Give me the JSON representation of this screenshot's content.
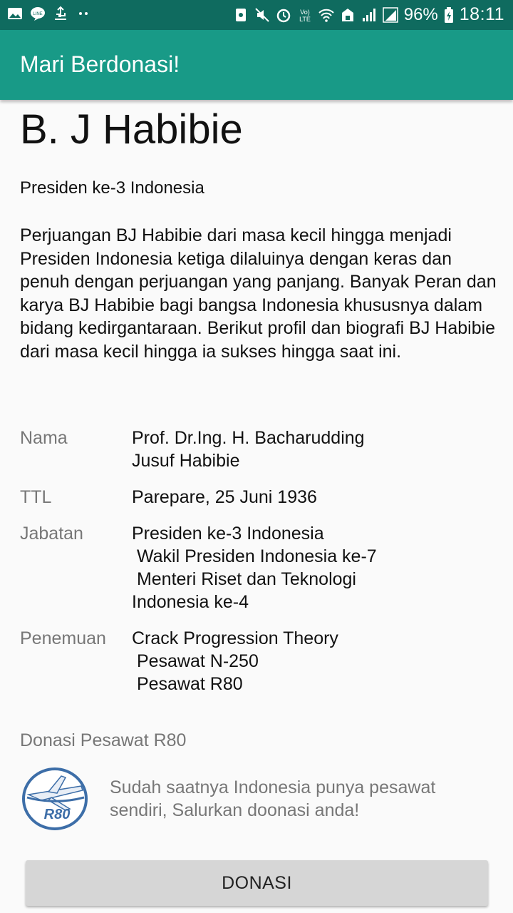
{
  "status_bar": {
    "battery": "96%",
    "time": "18:11",
    "left_icons": [
      "image-icon",
      "line-icon",
      "usb-icon",
      "dots-icon"
    ],
    "right_icons": [
      "nfc-icon",
      "mute-icon",
      "alarm-icon",
      "volte-icon",
      "wifi-icon",
      "data-icon",
      "signal-icon",
      "signal2-icon",
      "battery-icon"
    ]
  },
  "appbar": {
    "title": "Mari Berdonasi!"
  },
  "profile": {
    "name": "B. J Habibie",
    "subtitle": "Presiden ke-3 Indonesia",
    "bio": "Perjuangan BJ Habibie dari masa kecil hingga menjadi Presiden Indonesia ketiga dilaluinya dengan keras dan penuh dengan perjuangan yang panjang. Banyak Peran dan karya BJ Habibie bagi bangsa Indonesia khususnya dalam bidang kedirgantaraan. Berikut profil dan biografi BJ Habibie dari masa kecil hingga ia sukses hingga saat ini."
  },
  "info": [
    {
      "label": "Nama",
      "value": "Prof. Dr.Ing. H. Bacharudding\nJusuf Habibie"
    },
    {
      "label": "TTL",
      "value": "Parepare, 25 Juni 1936"
    },
    {
      "label": "Jabatan",
      "value": "Presiden ke-3 Indonesia\n Wakil Presiden Indonesia ke-7\n Menteri Riset dan Teknologi\nIndonesia ke-4"
    },
    {
      "label": "Penemuan",
      "value": "Crack Progression Theory\n Pesawat N-250\n Pesawat R80"
    }
  ],
  "donation": {
    "title": "Donasi Pesawat R80",
    "logo_text": "R80",
    "description": "Sudah saatnya Indonesia punya pesawat sendiri, Salurkan doonasi anda!",
    "button_label": "DONASI"
  },
  "colors": {
    "status_bar": "#0f6b5f",
    "appbar": "#189a87",
    "button": "#d6d6d6"
  }
}
